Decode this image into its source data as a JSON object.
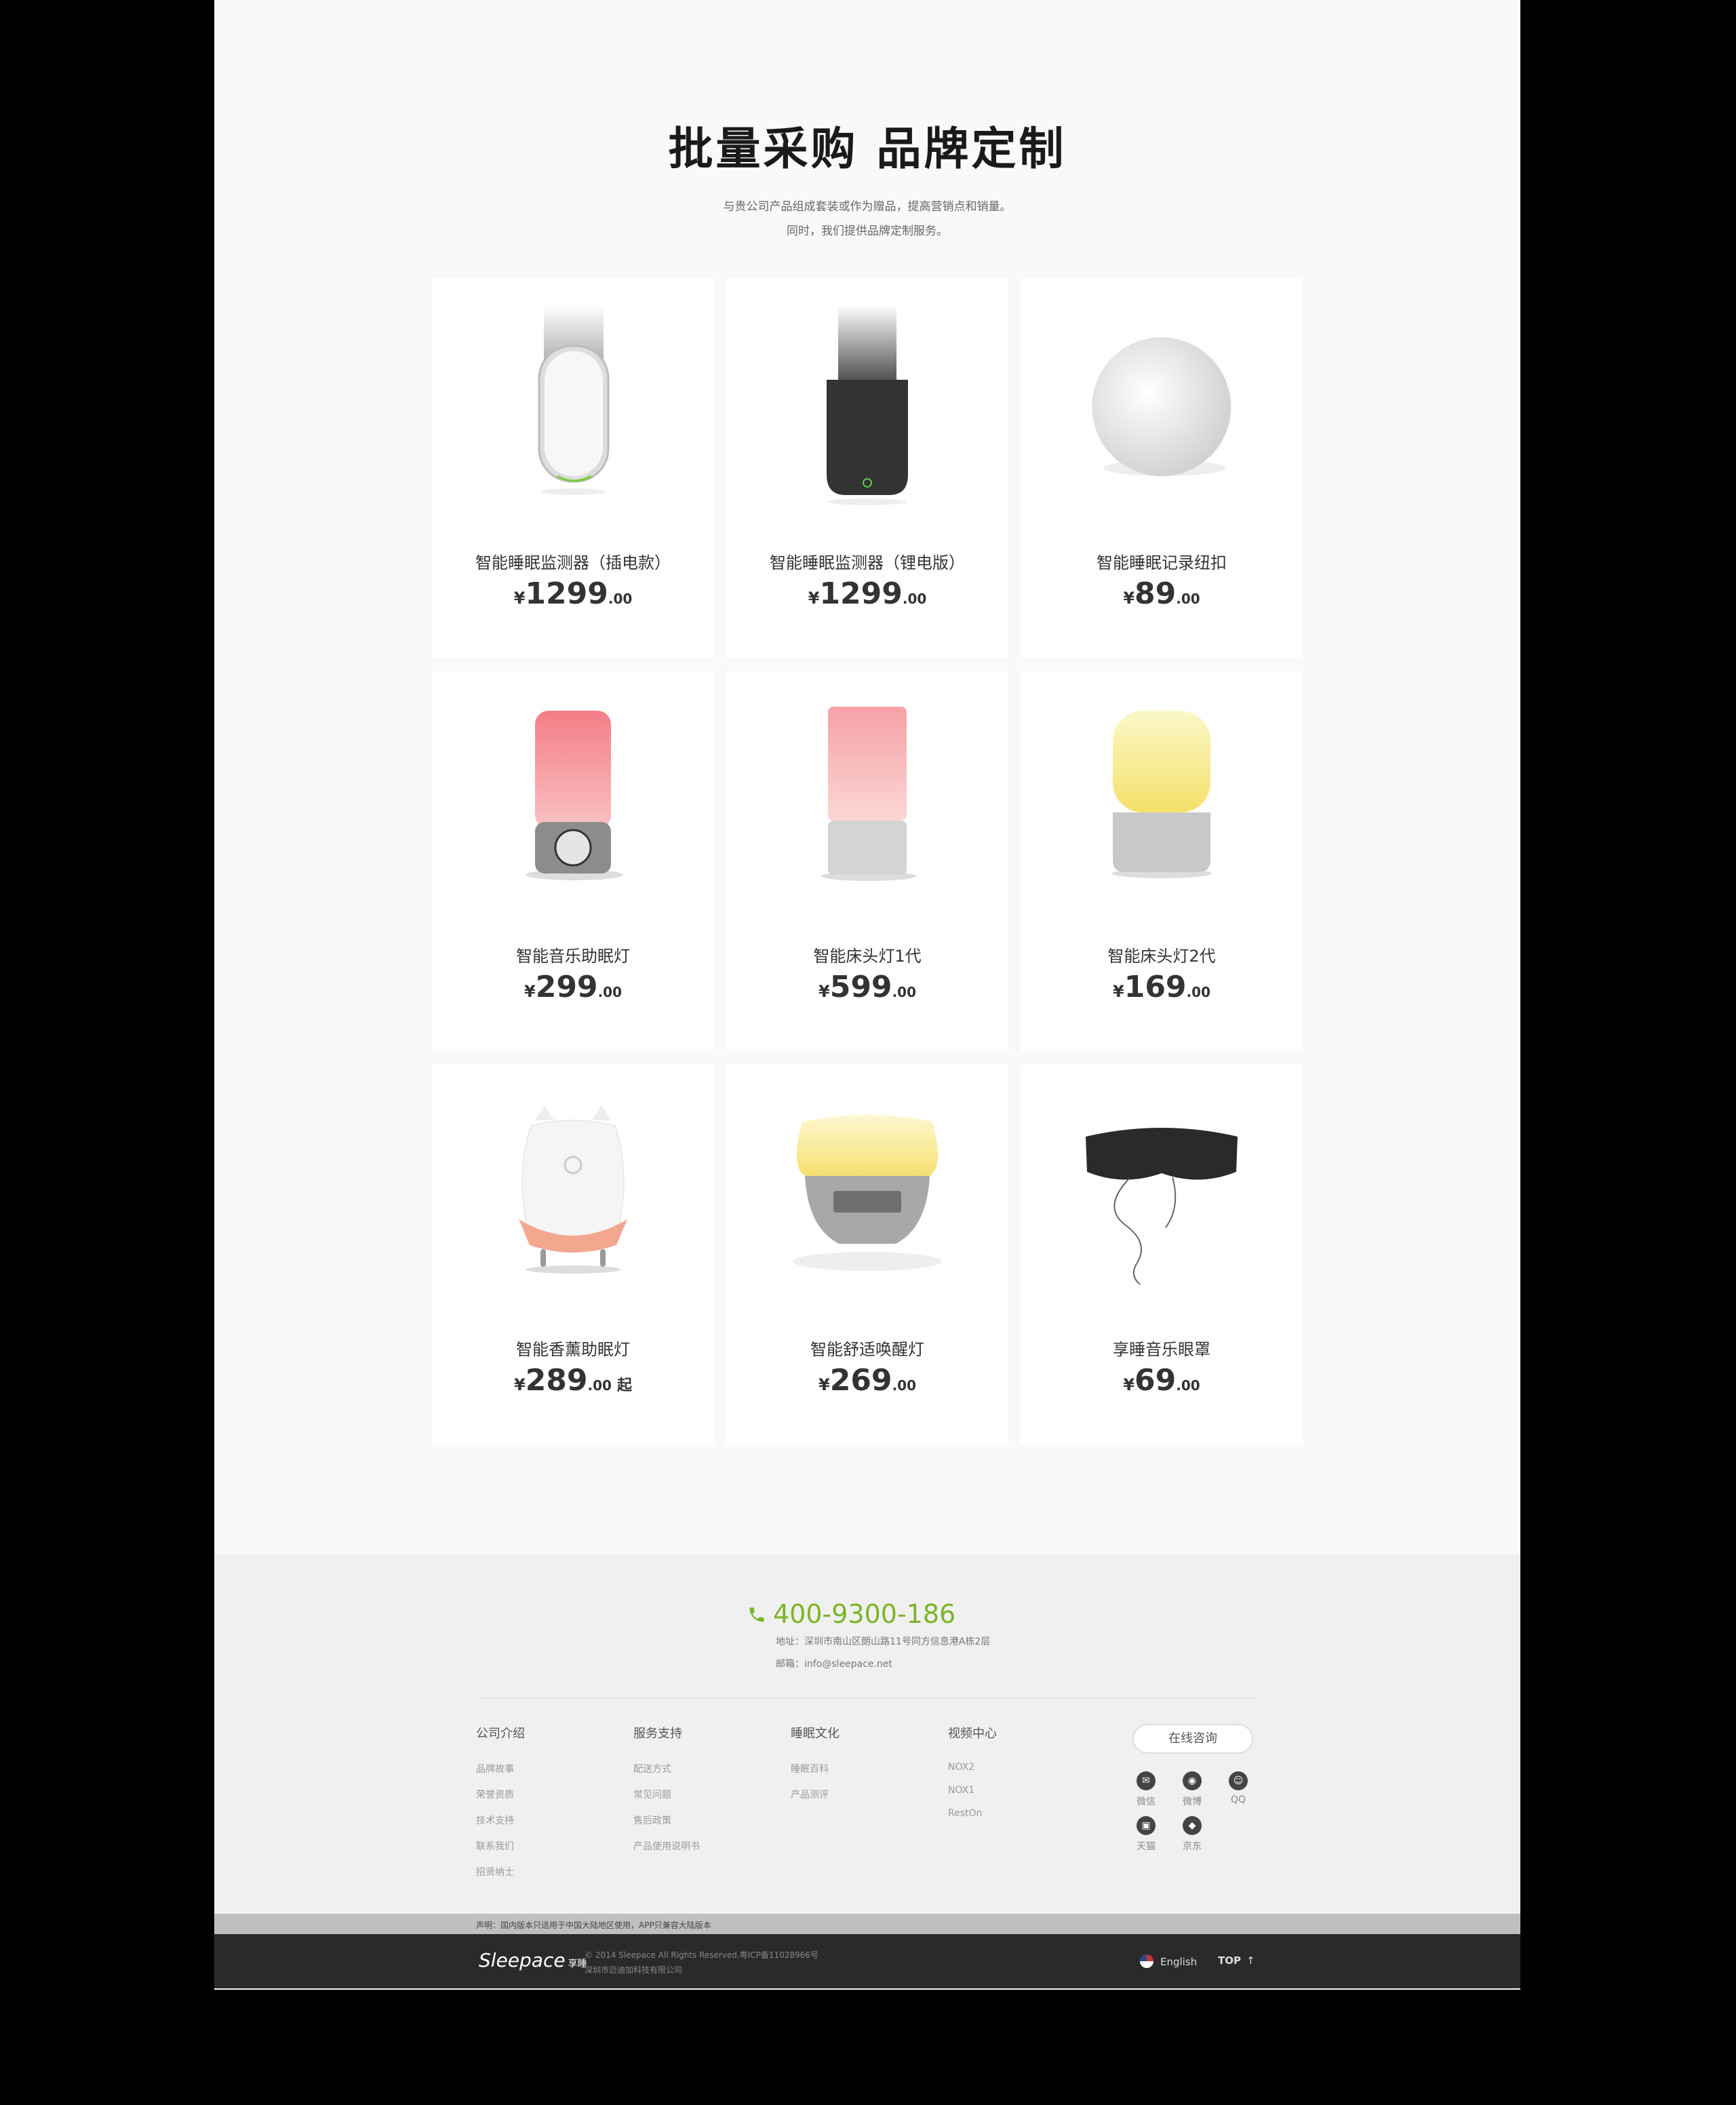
{
  "hero": {
    "title": "批量采购 品牌定制",
    "subtitle_line1": "与贵公司产品组成套装或作为赠品，提高营销点和销量。",
    "subtitle_line2": "同时，我们提供品牌定制服务。"
  },
  "products": [
    {
      "name": "智能睡眠监测器（插电款）",
      "yen": "¥",
      "price_int": "1299",
      "price_dec": ".00",
      "suffix": "",
      "icon": "sleep-monitor-white-icon"
    },
    {
      "name": "智能睡眠监测器（锂电版）",
      "yen": "¥",
      "price_int": "1299",
      "price_dec": ".00",
      "suffix": "",
      "icon": "sleep-monitor-black-icon"
    },
    {
      "name": "智能睡眠记录纽扣",
      "yen": "¥",
      "price_int": "89",
      "price_dec": ".00",
      "suffix": "",
      "icon": "sleep-button-icon"
    },
    {
      "name": "智能音乐助眠灯",
      "yen": "¥",
      "price_int": "299",
      "price_dec": ".00",
      "suffix": "",
      "icon": "music-lamp-icon"
    },
    {
      "name": "智能床头灯1代",
      "yen": "¥",
      "price_int": "599",
      "price_dec": ".00",
      "suffix": "",
      "icon": "bedside-lamp-1-icon"
    },
    {
      "name": "智能床头灯2代",
      "yen": "¥",
      "price_int": "169",
      "price_dec": ".00",
      "suffix": "",
      "icon": "bedside-lamp-2-icon"
    },
    {
      "name": "智能香薰助眠灯",
      "yen": "¥",
      "price_int": "289",
      "price_dec": ".00",
      "suffix": "起",
      "icon": "aroma-lamp-icon"
    },
    {
      "name": "智能舒适唤醒灯",
      "yen": "¥",
      "price_int": "269",
      "price_dec": ".00",
      "suffix": "",
      "icon": "wakeup-lamp-icon"
    },
    {
      "name": "享睡音乐眼罩",
      "yen": "¥",
      "price_int": "69",
      "price_dec": ".00",
      "suffix": "",
      "icon": "music-eyemask-icon"
    }
  ],
  "footer": {
    "phone": "400-9300-186",
    "address": "地址：深圳市南山区朗山路11号同方信息港A栋2层",
    "email": "邮箱：info@sleepace.net",
    "columns": [
      {
        "title": "公司介绍",
        "links": [
          "品牌故事",
          "荣誉资质",
          "技术支持",
          "联系我们",
          "招贤纳士"
        ]
      },
      {
        "title": "服务支持",
        "links": [
          "配送方式",
          "常见问题",
          "售后政策",
          "产品使用说明书"
        ]
      },
      {
        "title": "睡眠文化",
        "links": [
          "睡眠百科",
          "产品测评"
        ]
      },
      {
        "title": "视频中心",
        "links": [
          "NOX2",
          "NOX1",
          "RestOn"
        ]
      }
    ],
    "consult_label": "在线咨询",
    "social": [
      {
        "label": "微信",
        "icon": "wechat-icon"
      },
      {
        "label": "微博",
        "icon": "weibo-icon"
      },
      {
        "label": "QQ",
        "icon": "qq-icon"
      },
      {
        "label": "天猫",
        "icon": "tmall-icon"
      },
      {
        "label": "京东",
        "icon": "jd-icon"
      }
    ],
    "notice": "声明：国内版本只适用于中国大陆地区使用，APP只兼容大陆版本",
    "logo": "Sleepace",
    "logo_cn": "享睡",
    "copyright1": "© 2014 Sleepace All Rights Reserved.粤ICP备11028966号",
    "copyright2": "深圳市迈迪加科技有限公司",
    "language": "English",
    "top_label": "TOP",
    "top_arrow": "↑"
  },
  "colors": {
    "accent_green": "#7cb526",
    "page_bg": "#f9f9f9",
    "footer_bg": "#f0f0f0",
    "bottom_bar": "#2a2a2a"
  }
}
